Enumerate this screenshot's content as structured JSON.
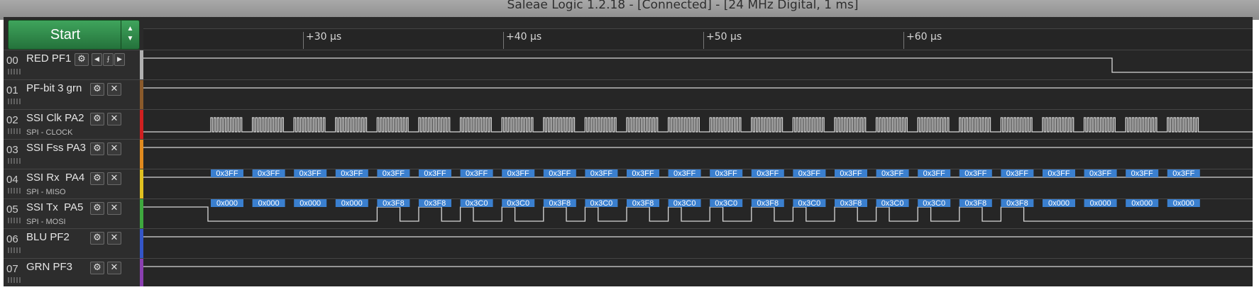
{
  "window": {
    "title": "Saleae Logic 1.2.18 - [Connected] - [24 MHz Digital, 1 ms]"
  },
  "toolbar": {
    "start_label": "Start",
    "up_arrow": "▲",
    "down_arrow": "▼"
  },
  "ruler": {
    "ticks": [
      {
        "label": "+30 µs",
        "time_us": 30
      },
      {
        "label": "+40 µs",
        "time_us": 40
      },
      {
        "label": "+50 µs",
        "time_us": 50
      },
      {
        "label": "+60 µs",
        "time_us": 60
      }
    ]
  },
  "channels": [
    {
      "num": "00",
      "name": "RED PF1",
      "sub": "",
      "color": "#b0b0b0",
      "controls": [
        "gear",
        "prev",
        "edge",
        "next"
      ]
    },
    {
      "num": "01",
      "name": "PF-bit 3 grn",
      "sub": "",
      "color": "#8a5a2b",
      "controls": [
        "gear",
        "close"
      ]
    },
    {
      "num": "02",
      "name": "SSI Clk PA2",
      "sub": "SPI - CLOCK",
      "color": "#d02020",
      "controls": [
        "gear",
        "close"
      ]
    },
    {
      "num": "03",
      "name": "SSI Fss PA3",
      "sub": "",
      "color": "#e08a1e",
      "controls": [
        "gear",
        "close"
      ]
    },
    {
      "num": "04",
      "name": "SSI Rx  PA4",
      "sub": "SPI - MISO",
      "color": "#e0c020",
      "controls": [
        "gear",
        "close"
      ]
    },
    {
      "num": "05",
      "name": "SSI Tx  PA5",
      "sub": "SPI - MOSI",
      "color": "#3ea83e",
      "controls": [
        "gear",
        "close"
      ]
    },
    {
      "num": "06",
      "name": "BLU PF2",
      "sub": "",
      "color": "#3456c8",
      "controls": [
        "gear",
        "close"
      ]
    },
    {
      "num": "07",
      "name": "GRN PF3",
      "sub": "",
      "color": "#8a3fb0",
      "controls": [
        "gear",
        "close"
      ]
    }
  ],
  "decoder": {
    "miso_values": [
      "0x3FF",
      "0x3FF",
      "0x3FF",
      "0x3FF",
      "0x3FF",
      "0x3FF",
      "0x3FF",
      "0x3FF",
      "0x3FF",
      "0x3FF",
      "0x3FF",
      "0x3FF",
      "0x3FF",
      "0x3FF",
      "0x3FF",
      "0x3FF",
      "0x3FF",
      "0x3FF",
      "0x3FF",
      "0x3FF",
      "0x3FF",
      "0x3FF",
      "0x3FF",
      "0x3FF"
    ],
    "mosi_values": [
      "0x000",
      "0x000",
      "0x000",
      "0x000",
      "0x3F8",
      "0x3F8",
      "0x3C0",
      "0x3C0",
      "0x3F8",
      "0x3C0",
      "0x3F8",
      "0x3C0",
      "0x3C0",
      "0x3F8",
      "0x3C0",
      "0x3F8",
      "0x3C0",
      "0x3C0",
      "0x3F8",
      "0x3F8",
      "0x000",
      "0x000",
      "0x000",
      "0x000"
    ],
    "label_bg": "#3a7fcf"
  },
  "colors": {
    "trace": "#d8d8d8",
    "background": "#2a2a2a"
  }
}
